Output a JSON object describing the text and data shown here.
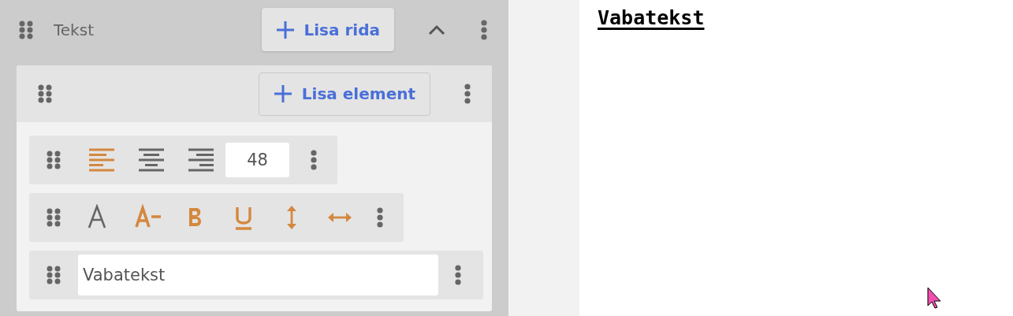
{
  "section": {
    "title": "Tekst",
    "add_row_button": "Lisa rida",
    "expanded": true
  },
  "row": {
    "add_element_button": "Lisa element"
  },
  "alignment": [
    {
      "kind": "left",
      "selected": true
    },
    {
      "kind": "center",
      "selected": false
    },
    {
      "kind": "right",
      "selected": false
    }
  ],
  "font_size": "48",
  "format_toggles": [
    {
      "kind": "font",
      "on": false
    },
    {
      "kind": "size-decrease",
      "on": true
    },
    {
      "kind": "bold",
      "on": true
    },
    {
      "kind": "underline",
      "on": true
    },
    {
      "kind": "vertical-spacing",
      "on": true
    },
    {
      "kind": "horizontal-spacing",
      "on": true
    }
  ],
  "text_field": {
    "value": "Vabatekst"
  },
  "preview": {
    "text": "Vabatekst"
  }
}
